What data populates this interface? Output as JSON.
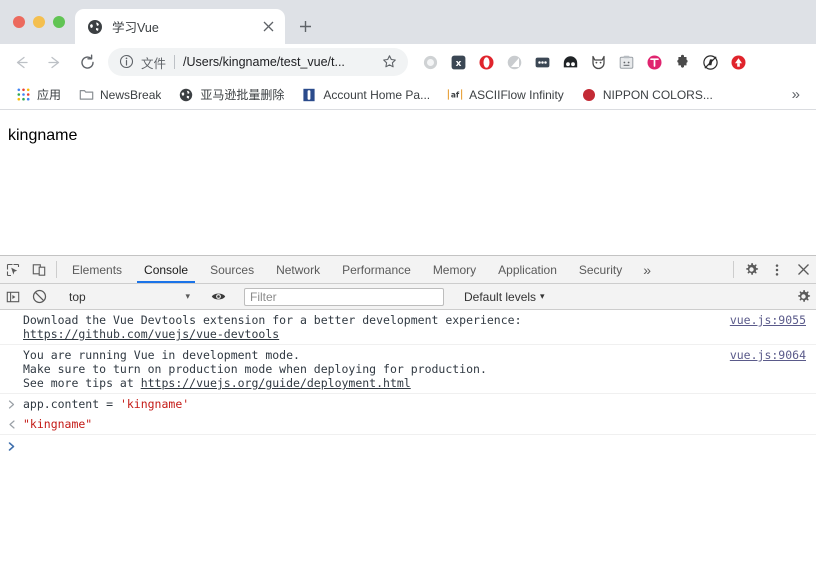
{
  "window": {
    "traffic_lights": [
      "close",
      "minimize",
      "zoom"
    ]
  },
  "tab": {
    "title": "学习Vue",
    "favicon": "globe-icon",
    "close_label": "×",
    "newtab_label": "+"
  },
  "toolbar": {
    "back_label": "←",
    "forward_label": "→",
    "reload_label": "⟳",
    "omnibox": {
      "info_icon": "info-circle-icon",
      "scheme_label": "文件",
      "url": "/Users/kingname/test_vue/t...",
      "star_icon": "star-icon"
    },
    "extensions": [
      {
        "name": "grey-ring-extension",
        "glyph": "○"
      },
      {
        "name": "dark-x-extension",
        "glyph": "x"
      },
      {
        "name": "red-opera-extension",
        "glyph": "●"
      },
      {
        "name": "grey-circle-slash-extension",
        "glyph": "◐"
      },
      {
        "name": "dark-dots-extension",
        "glyph": "•••"
      },
      {
        "name": "dark-eyes-extension",
        "glyph": "••"
      },
      {
        "name": "fox-outline-extension",
        "glyph": "♆"
      },
      {
        "name": "clipboard-extension",
        "glyph": "▭"
      },
      {
        "name": "pink-circle-extension",
        "glyph": "⊤"
      },
      {
        "name": "puzzle-extension",
        "glyph": "🧩"
      },
      {
        "name": "crossed-circle-extension",
        "glyph": "∅"
      },
      {
        "name": "red-arrow-up-extension",
        "glyph": "▲"
      }
    ]
  },
  "bookmarks": {
    "items": [
      {
        "label": "应用",
        "icon": "apps-grid-icon"
      },
      {
        "label": "NewsBreak",
        "icon": "folder-icon"
      },
      {
        "label": "亚马逊批量删除",
        "icon": "globe-icon"
      },
      {
        "label": "Account Home Pa...",
        "icon": "blue-book-icon"
      },
      {
        "label": "ASCIIFlow Infinity",
        "icon": "af-text-icon"
      },
      {
        "label": "NIPPON COLORS...",
        "icon": "red-circle-icon"
      }
    ],
    "overflow_label": "»"
  },
  "page": {
    "content": "kingname"
  },
  "devtools": {
    "inspect_icon": "inspect-cursor-icon",
    "device_icon": "device-toolbar-icon",
    "tabs": [
      {
        "label": "Elements",
        "active": false
      },
      {
        "label": "Console",
        "active": true
      },
      {
        "label": "Sources",
        "active": false
      },
      {
        "label": "Network",
        "active": false
      },
      {
        "label": "Performance",
        "active": false
      },
      {
        "label": "Memory",
        "active": false
      },
      {
        "label": "Application",
        "active": false
      },
      {
        "label": "Security",
        "active": false
      }
    ],
    "more_tabs_label": "»",
    "settings_icon": "gear-icon",
    "kebab_icon": "more-vertical-icon",
    "close_icon": "close-icon",
    "filterbar": {
      "sidebar_icon": "show-console-sidebar-icon",
      "clear_icon": "clear-console-icon",
      "context": "top",
      "context_caret": "▾",
      "eye_icon": "live-expression-icon",
      "filter_placeholder": "Filter",
      "levels_label": "Default levels",
      "levels_caret": "▾",
      "gear_icon": "console-settings-icon"
    },
    "console": {
      "messages": [
        {
          "type": "log",
          "gutter": "",
          "lines": [
            {
              "text": "Download the Vue Devtools extension for a better development experience:",
              "link": false
            },
            {
              "text": "https://github.com/vuejs/vue-devtools",
              "link": true
            }
          ],
          "source": "vue.js:9055"
        },
        {
          "type": "log",
          "gutter": "",
          "lines": [
            {
              "text": "You are running Vue in development mode.",
              "link": false
            },
            {
              "text": "Make sure to turn on production mode when deploying for production.",
              "link": false
            },
            {
              "text": "See more tips at ",
              "link": false,
              "trailing_link": "https://vuejs.org/guide/deployment.html"
            }
          ],
          "source": "vue.js:9064"
        }
      ],
      "command": {
        "gutter": "❯",
        "code_prefix": "app.content = ",
        "code_string": "'kingname'"
      },
      "result": {
        "gutter": "❮",
        "value": "\"kingname\""
      },
      "prompt": {
        "gutter": "❯",
        "value": ""
      }
    }
  },
  "colors": {
    "chrome_tabstrip": "#dee1e6",
    "accent_blue": "#1a73e8",
    "console_string_red": "#c41a16",
    "source_link": "#5a5a8a",
    "prompt_blue": "#3f6fad"
  }
}
